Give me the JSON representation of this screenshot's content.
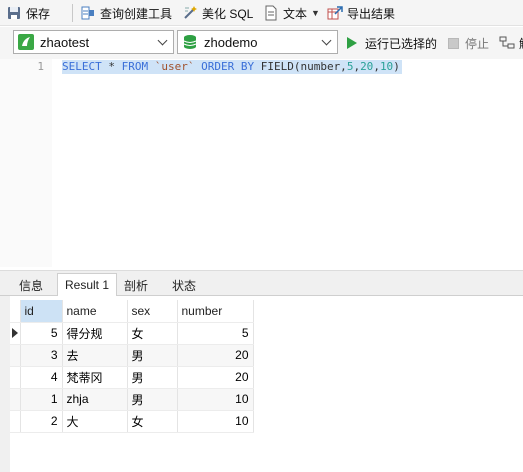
{
  "toolbar": {
    "save": "保存",
    "query_builder": "查询创建工具",
    "beautify": "美化 SQL",
    "text": "文本",
    "export": "导出结果"
  },
  "selectors": {
    "connection": "zhaotest",
    "database": "zhodemo",
    "run_selected": "运行已选择的",
    "stop": "停止",
    "explain": "解"
  },
  "editor": {
    "line_number": "1",
    "sql_tokens": [
      {
        "t": "SELECT",
        "c": "kw"
      },
      {
        "t": " * ",
        "c": "pl"
      },
      {
        "t": "FROM",
        "c": "kw"
      },
      {
        "t": " `user` ",
        "c": "str"
      },
      {
        "t": "ORDER BY",
        "c": "kw"
      },
      {
        "t": " FIELD(number,",
        "c": "pl"
      },
      {
        "t": "5",
        "c": "num"
      },
      {
        "t": ",",
        "c": "pl"
      },
      {
        "t": "20",
        "c": "num"
      },
      {
        "t": ",",
        "c": "pl"
      },
      {
        "t": "10",
        "c": "num"
      },
      {
        "t": ")",
        "c": "pl"
      }
    ]
  },
  "tabs": [
    "信息",
    "Result 1",
    "剖析",
    "状态"
  ],
  "table": {
    "columns": [
      "id",
      "name",
      "sex",
      "number"
    ],
    "rows": [
      [
        "5",
        "得分规",
        "女",
        "5"
      ],
      [
        "3",
        "去",
        "男",
        "20"
      ],
      [
        "4",
        "梵蒂冈",
        "男",
        "20"
      ],
      [
        "1",
        "zhja",
        "男",
        "10"
      ],
      [
        "2",
        "大",
        "女",
        "10"
      ]
    ]
  },
  "colors": {
    "run_green": "#2ea043",
    "keyword_blue": "#3a6fd8",
    "number_teal": "#2aa198",
    "selection": "#cfe3f7"
  }
}
